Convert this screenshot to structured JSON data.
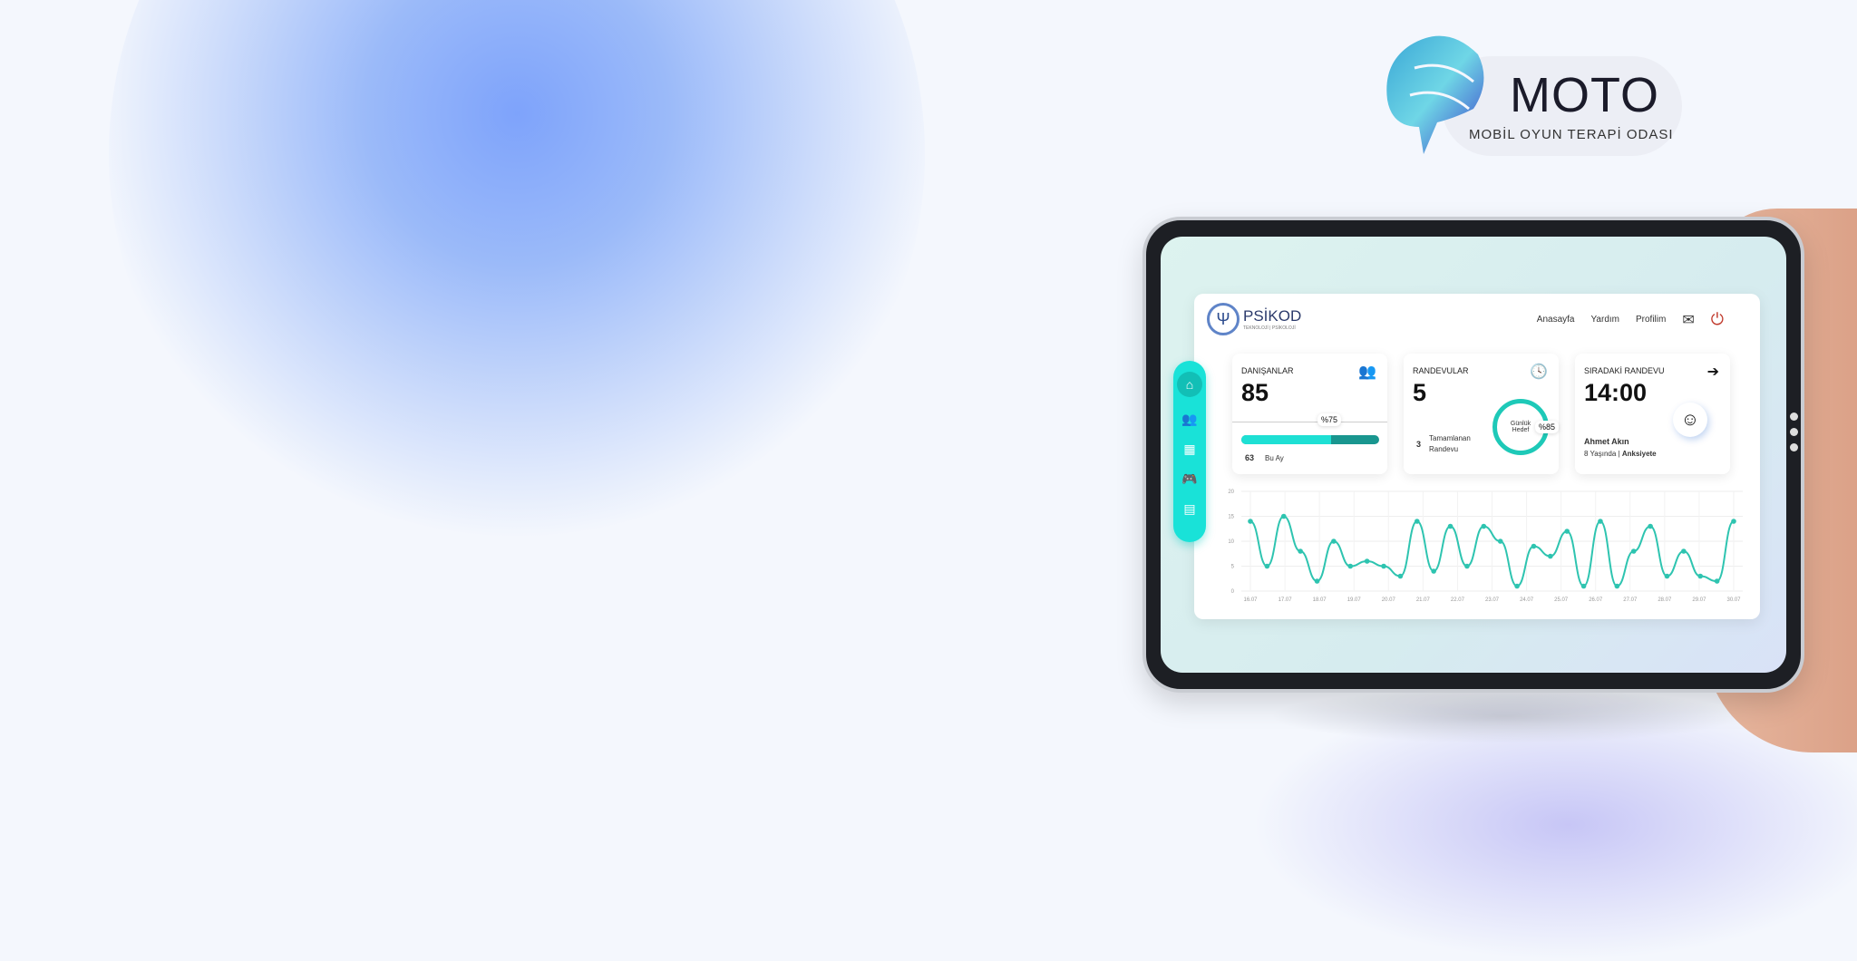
{
  "brand": {
    "name": "MOTO",
    "subtitle": "MOBİL OYUN TERAPİ ODASI"
  },
  "app": {
    "name": "PSİKOD",
    "tagline": "TEKNOLOJİ | PSİKOLOJİ"
  },
  "nav": {
    "items": [
      "Anasayfa",
      "Yardım",
      "Profilim"
    ],
    "mail_icon": "mail-icon",
    "power_icon": "power-icon"
  },
  "sidebar": {
    "items": [
      "home",
      "users",
      "calendar",
      "gamepad",
      "note"
    ]
  },
  "cards": {
    "clients": {
      "title": "DANIŞANLAR",
      "value": "85",
      "percent_label": "%75",
      "progress": 0.65,
      "month_count": "63",
      "month_label": "Bu Ay"
    },
    "appointments": {
      "title": "RANDEVULAR",
      "value": "5",
      "completed_count": "3",
      "completed_label": "Tamamlanan Randevu",
      "goal_label": "Günlük Hedef",
      "goal_percent": "%85"
    },
    "next": {
      "title": "SIRADAKİ RANDEVU",
      "time": "14:00",
      "name": "Ahmet Akın",
      "age": "8 Yaşında",
      "diagnosis": "Anksiyete"
    }
  },
  "colors": {
    "accent": "#19e2d8",
    "line": "#2ec4b0"
  },
  "chart_data": {
    "type": "line",
    "yticks": [
      0,
      5,
      10,
      15,
      20
    ],
    "ylim": [
      0,
      20
    ],
    "xlabels": [
      "16.07",
      "17.07",
      "18.07",
      "19.07",
      "20.07",
      "21.07",
      "22.07",
      "23.07",
      "24.07",
      "25.07",
      "26.07",
      "27.07",
      "28.07",
      "29.07",
      "30.07"
    ],
    "values": [
      14,
      5,
      15,
      8,
      2,
      10,
      5,
      6,
      5,
      3,
      14,
      4,
      13,
      5,
      13,
      10,
      1,
      9,
      7,
      12,
      1,
      14,
      1,
      8,
      13,
      3,
      8,
      3,
      2,
      14
    ]
  }
}
